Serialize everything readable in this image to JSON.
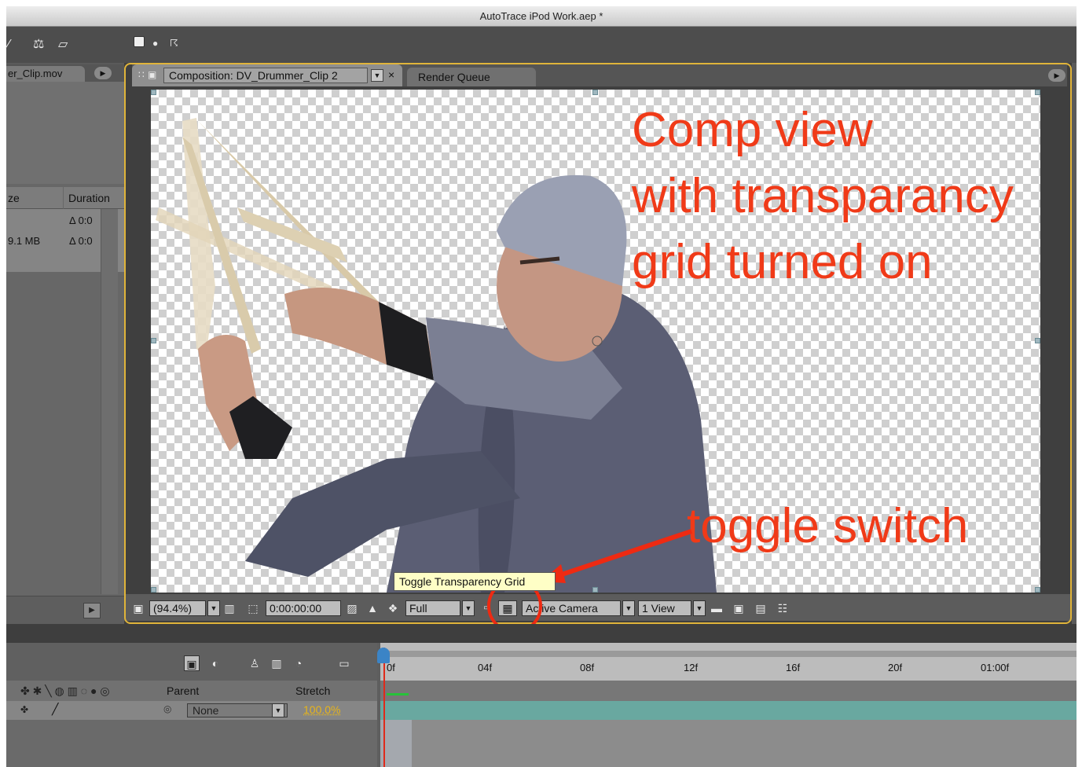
{
  "window": {
    "title": "AutoTrace iPod Work.aep *"
  },
  "project": {
    "tab_label": "er_Clip.mov",
    "columns": {
      "size": "ze",
      "duration": "Duration"
    },
    "rows": [
      {
        "size": "",
        "duration": "Δ 0:0"
      },
      {
        "size": "9.1 MB",
        "duration": "Δ 0:0"
      }
    ]
  },
  "composition": {
    "tab_label": "Composition: DV_Drummer_Clip 2",
    "render_queue_label": "Render Queue",
    "annotation_main": "Comp view\nwith transparancy\ngrid turned on",
    "annotation_toggle": "toggle switch"
  },
  "viewer_bar": {
    "zoom": "(94.4%)",
    "timecode": "0:00:00:00",
    "resolution": "Full",
    "camera": "Active Camera",
    "views": "1 View"
  },
  "tooltip": "Toggle Transparency Grid",
  "timeline": {
    "ruler_ticks": [
      "0f",
      "04f",
      "08f",
      "12f",
      "16f",
      "20f",
      "01:00f"
    ],
    "headers": {
      "parent": "Parent",
      "stretch": "Stretch"
    },
    "layer": {
      "parent": "None",
      "stretch": "100.0%"
    }
  },
  "colors": {
    "annotation": "#f03a18",
    "panel_highlight": "#e0b43a",
    "layer_bar": "#69a8a0",
    "tooltip_bg": "#fefec6"
  },
  "icons": [
    "brush-icon",
    "stamp-icon",
    "eraser-icon",
    "pan-behind-icon",
    "puppet-pin-icon",
    "composition-icon",
    "snapshot-icon",
    "color-channels-icon",
    "transparency-grid-icon",
    "region-of-interest-icon",
    "safe-zones-icon",
    "flowchart-icon"
  ]
}
